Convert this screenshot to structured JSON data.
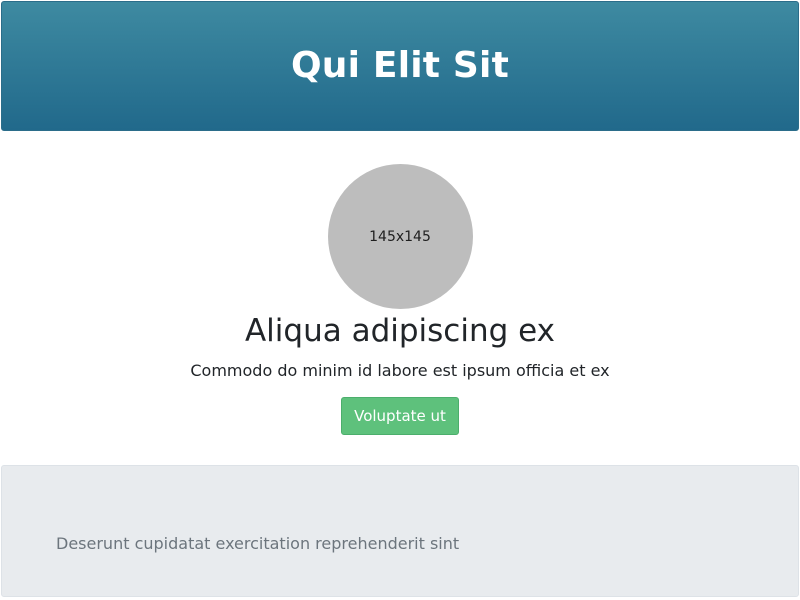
{
  "header": {
    "title": "Qui Elit Sit"
  },
  "profile": {
    "avatar_placeholder": "145x145",
    "title": "Aliqua adipiscing ex",
    "description": "Commodo do minim id labore est ipsum officia et ex",
    "button_label": "Voluptate ut"
  },
  "footer": {
    "text": "Deserunt cupidatat exercitation reprehenderit sint"
  },
  "colors": {
    "header_top": "#3e8aa1",
    "header_bottom": "#21698b",
    "avatar_bg": "#bdbdbd",
    "button_bg": "#5ec17c",
    "footer_bg": "#e8ebee"
  }
}
